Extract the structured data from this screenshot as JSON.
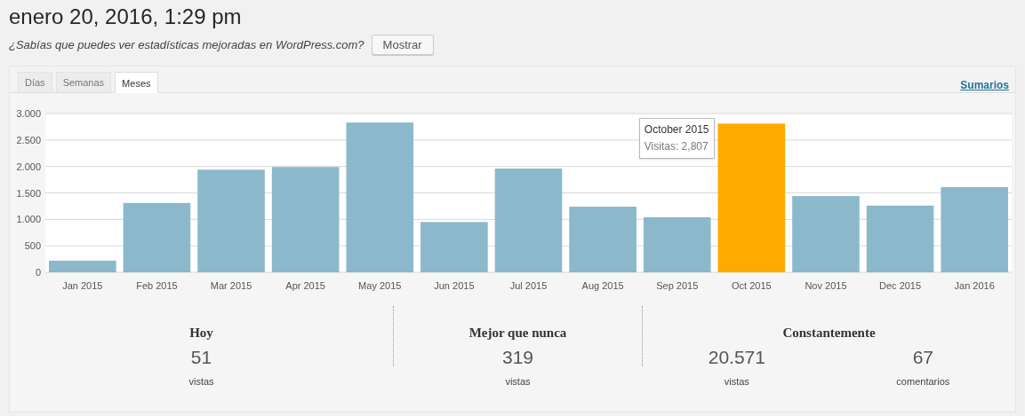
{
  "title": "enero 20, 2016, 1:29 pm",
  "notice": {
    "text": "¿Sabías que puedes ver estadísticas mejoradas en WordPress.com?",
    "button": "Mostrar"
  },
  "tabs": [
    {
      "label": "Días",
      "selected": false
    },
    {
      "label": "Semanas",
      "selected": false
    },
    {
      "label": "Meses",
      "selected": true
    }
  ],
  "summary_link": "Sumarios",
  "chart_data": {
    "type": "bar",
    "categories": [
      "Jan 2015",
      "Feb 2015",
      "Mar 2015",
      "Apr 2015",
      "May 2015",
      "Jun 2015",
      "Jul 2015",
      "Aug 2015",
      "Sep 2015",
      "Oct 2015",
      "Nov 2015",
      "Dec 2015",
      "Jan 2016"
    ],
    "series": [
      {
        "color": "#8cb8cc",
        "values": [
          220,
          1310,
          1940,
          1990,
          2830,
          950,
          1960,
          1240,
          1040,
          null,
          1440,
          1260,
          1610
        ]
      },
      {
        "color": "#ffaa00",
        "values": [
          null,
          null,
          null,
          null,
          null,
          null,
          null,
          null,
          null,
          2810,
          null,
          null,
          null
        ]
      }
    ],
    "stacked": true,
    "grid": true,
    "ylim": [
      0,
      3000
    ],
    "yticks": [
      {
        "value": 0,
        "label": "0"
      },
      {
        "value": 500,
        "label": "500"
      },
      {
        "value": 1000,
        "label": "1.000"
      },
      {
        "value": 1500,
        "label": "1.500"
      },
      {
        "value": 2000,
        "label": "2.000"
      },
      {
        "value": 2500,
        "label": "2.500"
      },
      {
        "value": 3000,
        "label": "3.000"
      }
    ],
    "annotations": [
      "October 2015",
      "Visitas: 2,807"
    ]
  },
  "stats": [
    {
      "heading": "Hoy",
      "items": [
        {
          "value": "51",
          "label": "vistas"
        }
      ]
    },
    {
      "heading": "Mejor que nunca",
      "items": [
        {
          "value": "319",
          "label": "vistas"
        }
      ]
    },
    {
      "heading": "Constantemente",
      "items": [
        {
          "value": "20.571",
          "label": "vistas"
        },
        {
          "value": "67",
          "label": "comentarios"
        }
      ]
    }
  ]
}
